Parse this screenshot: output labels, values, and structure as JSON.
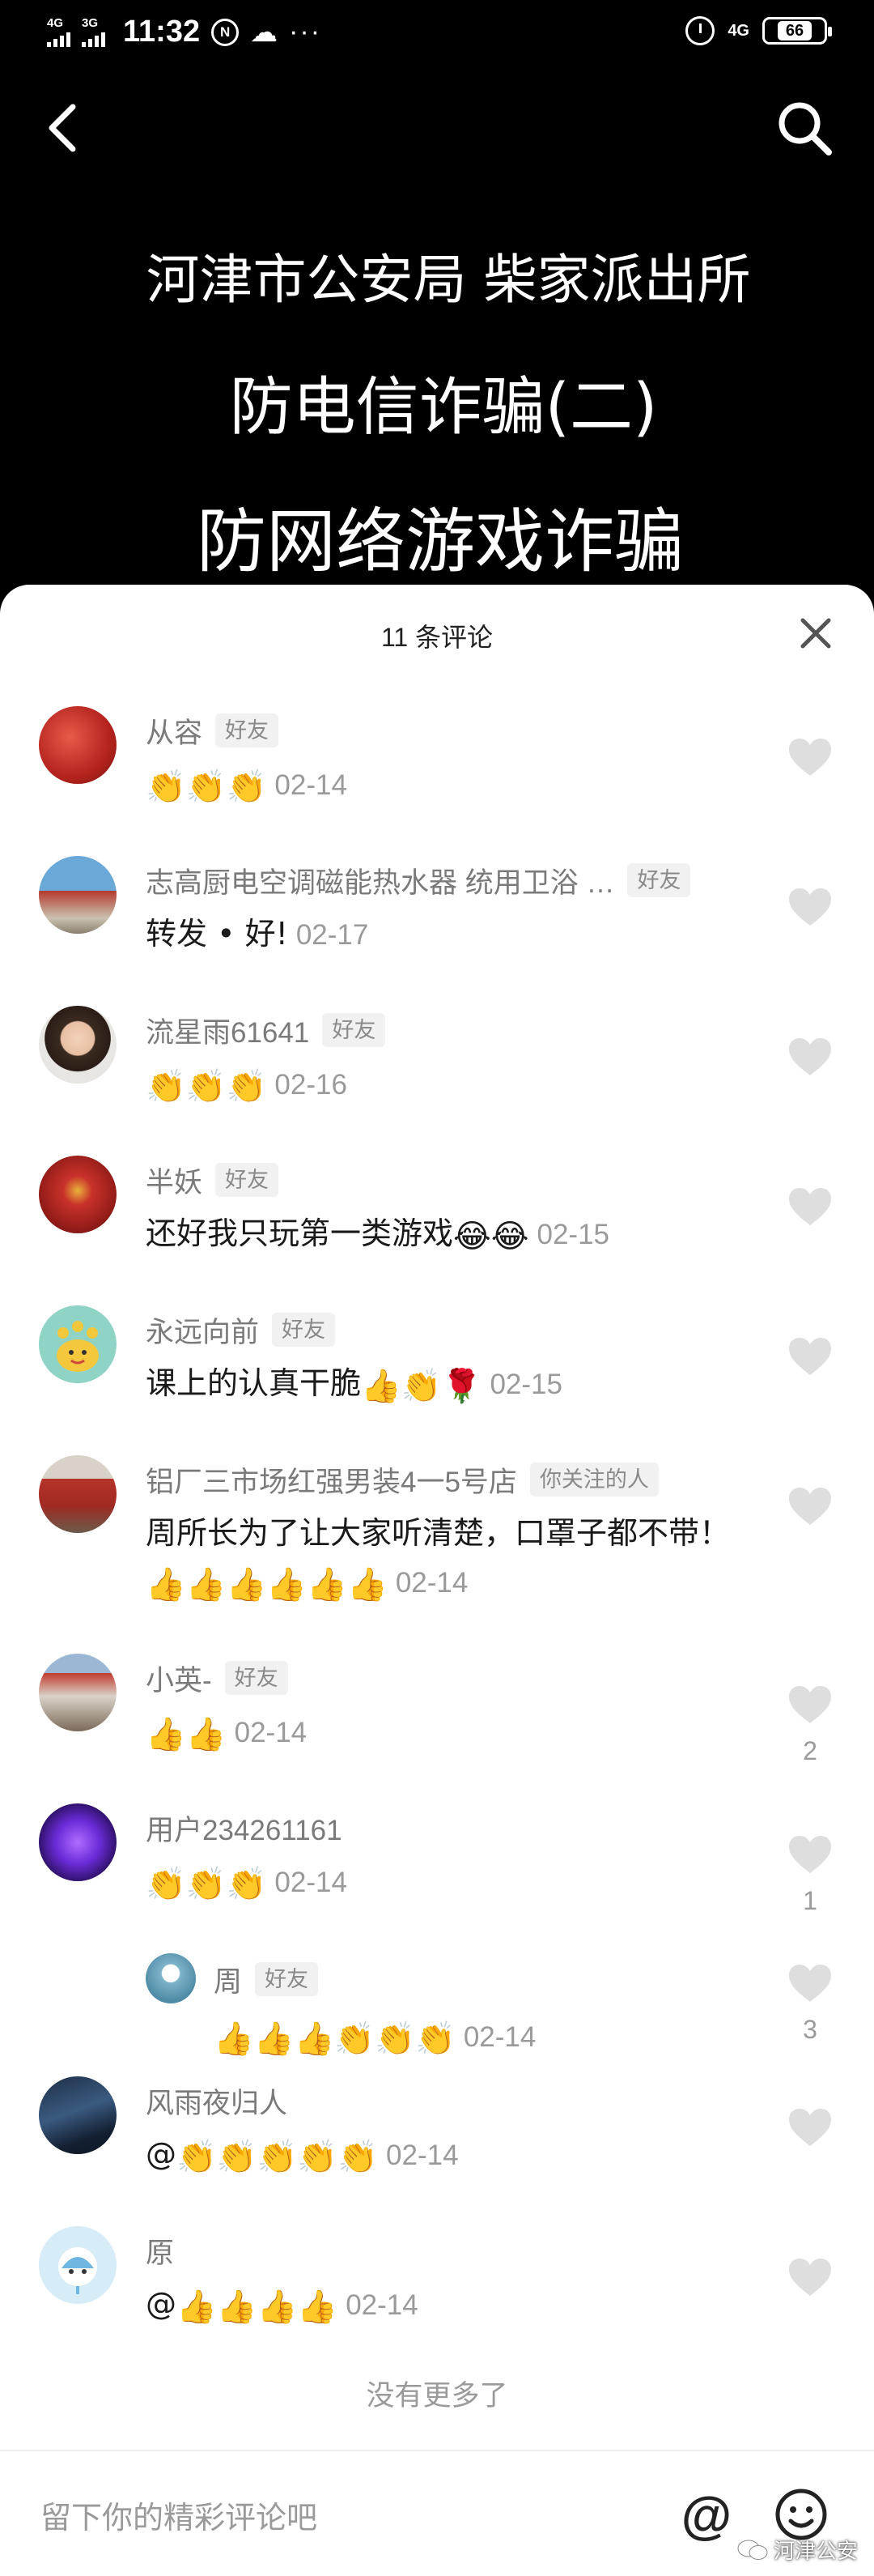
{
  "status_bar": {
    "signal1": "4G",
    "signal2": "3G",
    "time": "11:32",
    "circle_badge": "N",
    "network": "4G",
    "battery": "66"
  },
  "video": {
    "line1": "河津市公安局 柴家派出所",
    "line2": "防电信诈骗(二)",
    "line3": "防网络游戏诈骗"
  },
  "comments_panel": {
    "title": "11 条评论",
    "no_more": "没有更多了",
    "input_placeholder": "留下你的精彩评论吧",
    "at_symbol": "@",
    "watermark": "河津公安"
  },
  "comments": [
    {
      "name": "从容",
      "tag": "好友",
      "text": "",
      "emoji": "👏👏👏",
      "date": "02-14",
      "likes": ""
    },
    {
      "name": "志高厨电空调磁能热水器 统用卫浴 …",
      "tag": "好友",
      "text": "转发 • 好!",
      "emoji": "",
      "date": "02-17",
      "likes": ""
    },
    {
      "name": "流星雨61641",
      "tag": "好友",
      "text": "",
      "emoji": "👏👏👏",
      "date": "02-16",
      "likes": ""
    },
    {
      "name": "半妖",
      "tag": "好友",
      "text": "还好我只玩第一类游戏",
      "emoji": "😂😂",
      "date": "02-15",
      "likes": ""
    },
    {
      "name": "永远向前",
      "tag": "好友",
      "text": "课上的认真干脆",
      "emoji": "👍👏🌹",
      "date": "02-15",
      "likes": ""
    },
    {
      "name": "铝厂三市场红强男装4一5号店",
      "tag": "你关注的人",
      "text": "周所长为了让大家听清楚，口罩子都不带！",
      "emoji": "👍👍👍👍👍👍",
      "date": "02-14",
      "likes": ""
    },
    {
      "name": "小英-",
      "tag": "好友",
      "text": "",
      "emoji": "👍👍",
      "date": "02-14",
      "likes": "2"
    },
    {
      "name": "用户234261161",
      "tag": "",
      "text": "",
      "emoji": "👏👏👏",
      "date": "02-14",
      "likes": "1"
    },
    {
      "name": "周",
      "tag": "好友",
      "text": "",
      "emoji": "👍👍👍👏👏👏",
      "date": "02-14",
      "likes": "3"
    },
    {
      "name": "风雨夜归人",
      "tag": "",
      "text": "@",
      "emoji": "👏👏👏👏👏",
      "date": "02-14",
      "likes": ""
    },
    {
      "name": "原",
      "tag": "",
      "text": "@",
      "emoji": "👍👍👍👍",
      "date": "02-14",
      "likes": ""
    }
  ],
  "colors": {
    "background_dark": "#000000",
    "sheet": "#ffffff",
    "name_gray": "#7a7a7a",
    "date_gray": "#9a9a9a",
    "heart_gray": "#dddddd"
  }
}
